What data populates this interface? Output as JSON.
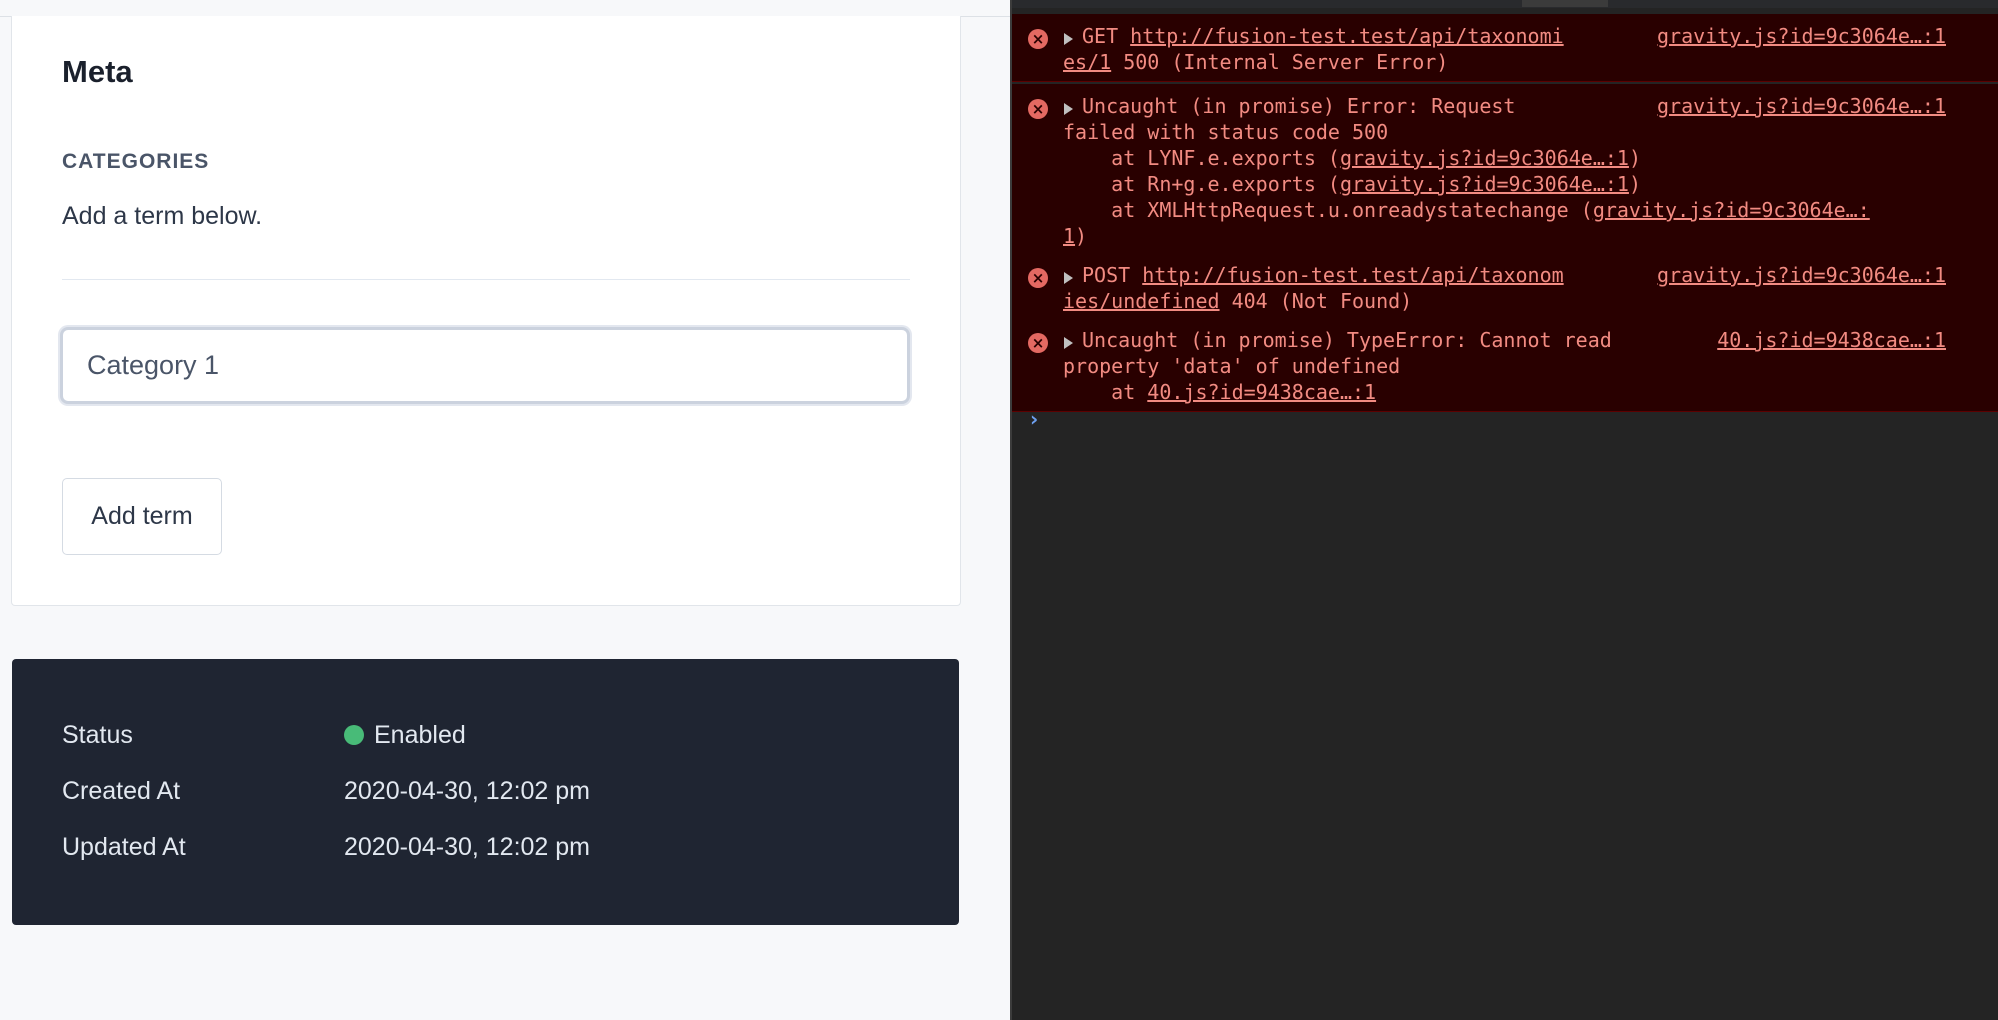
{
  "meta": {
    "title": "Meta",
    "categories_label": "CATEGORIES",
    "help_text": "Add a term below.",
    "term_input_value": "Category 1",
    "add_term_label": "Add term"
  },
  "status": {
    "status_label": "Status",
    "status_value": "Enabled",
    "status_color": "#48bb78",
    "created_label": "Created At",
    "created_value": "2020-04-30, 12:02 pm",
    "updated_label": "Updated At",
    "updated_value": "2020-04-30, 12:02 pm"
  },
  "console": {
    "messages": [
      {
        "lines": [
          {
            "prefix": "GET ",
            "link": "http://fusion-test.test/api/taxonomi",
            "suffix": ""
          },
          {
            "prefix": "",
            "link": "es/1",
            "suffix": " 500 (Internal Server Error)"
          }
        ],
        "source": "gravity.js?id=9c3064e…:1"
      },
      {
        "lines": [
          {
            "prefix": "Uncaught (in promise) Error: Request",
            "link": "",
            "suffix": ""
          },
          {
            "prefix": "failed with status code 500",
            "link": "",
            "suffix": ""
          },
          {
            "prefix": "    at LYNF.e.exports (",
            "link": "gravity.js?id=9c3064e…:1",
            "suffix": ")"
          },
          {
            "prefix": "    at Rn+g.e.exports (",
            "link": "gravity.js?id=9c3064e…:1",
            "suffix": ")"
          },
          {
            "prefix": "    at XMLHttpRequest.u.onreadystatechange (",
            "link": "gravity.js?id=9c3064e…:",
            "suffix": ""
          },
          {
            "prefix": "",
            "link": "1",
            "suffix": ")"
          }
        ],
        "source": "gravity.js?id=9c3064e…:1"
      },
      {
        "lines": [
          {
            "prefix": "POST ",
            "link": "http://fusion-test.test/api/taxonom",
            "suffix": ""
          },
          {
            "prefix": "",
            "link": "ies/undefined",
            "suffix": " 404 (Not Found)"
          }
        ],
        "source": "gravity.js?id=9c3064e…:1"
      },
      {
        "lines": [
          {
            "prefix": "Uncaught (in promise) TypeError: Cannot read",
            "link": "",
            "suffix": ""
          },
          {
            "prefix": "property 'data' of undefined",
            "link": "",
            "suffix": ""
          },
          {
            "prefix": "    at ",
            "link": "40.js?id=9438cae…:1",
            "suffix": ""
          }
        ],
        "source": "40.js?id=9438cae…:1"
      }
    ],
    "prompt_symbol": "›",
    "error_icon_glyph": "×"
  }
}
